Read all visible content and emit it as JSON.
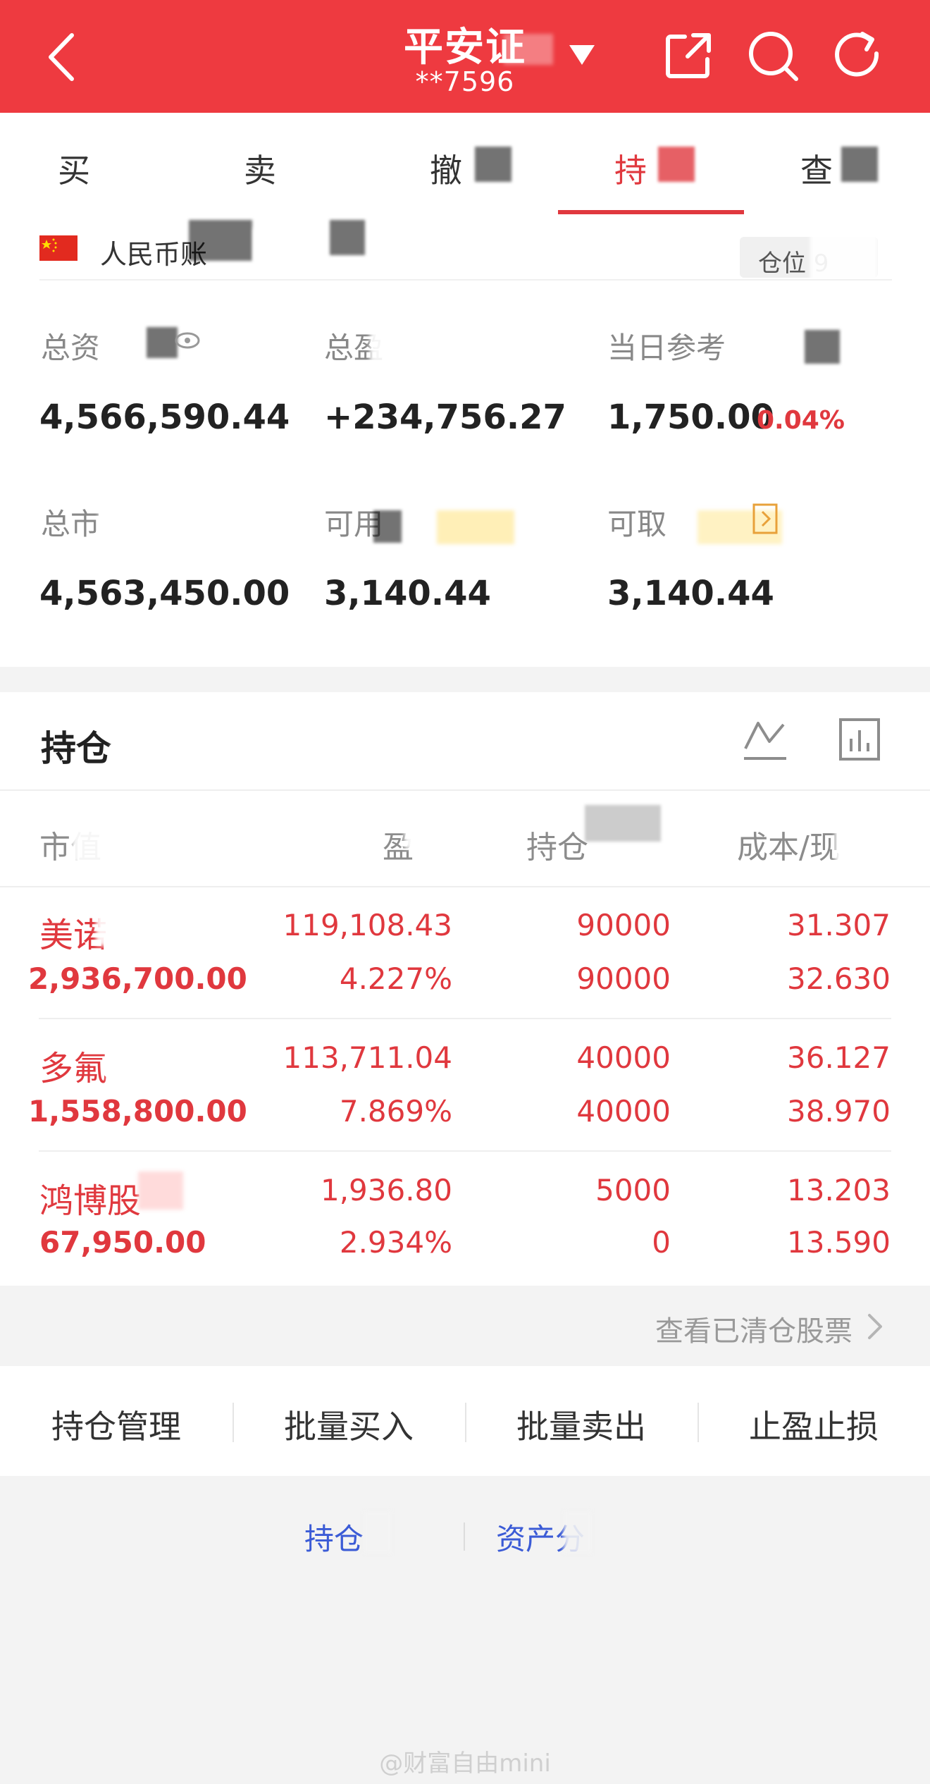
{
  "header": {
    "broker_name": "平安证",
    "account_masked": "**7596"
  },
  "tabs": [
    {
      "label": "买"
    },
    {
      "label": "卖"
    },
    {
      "label": "撤"
    },
    {
      "label": "持"
    },
    {
      "label": "查"
    }
  ],
  "account": {
    "currency_label": "人民币账",
    "position_badge": "仓位 9",
    "total_assets_label": "总资",
    "total_assets": "4,566,590.44",
    "total_pnl_label": "总盈",
    "total_pnl": "+234,756.27",
    "daily_ref_label": "当日参考",
    "daily_ref_value": "1,750.00",
    "daily_ref_pct": "0.04%",
    "total_market_label": "总市",
    "total_market_value": "4,563,450.00",
    "available_label": "可用",
    "available_value": "3,140.44",
    "withdrawable_label": "可取",
    "withdrawable_value": "3,140.44"
  },
  "holdings": {
    "title": "持仓",
    "columns": [
      "市值",
      "盈",
      "持仓",
      "成本/现"
    ],
    "rows": [
      {
        "name": "美诺",
        "market_value": "2,936,700.00",
        "pnl": "119,108.43",
        "pnl_pct": "4.227%",
        "qty": "90000",
        "available": "90000",
        "cost": "31.307",
        "price": "32.630"
      },
      {
        "name": "多氟",
        "market_value": "1,558,800.00",
        "pnl": "113,711.04",
        "pnl_pct": "7.869%",
        "qty": "40000",
        "available": "40000",
        "cost": "36.127",
        "price": "38.970"
      },
      {
        "name": "鸿博股",
        "market_value": "67,950.00",
        "pnl": "1,936.80",
        "pnl_pct": "2.934%",
        "qty": "5000",
        "available": "0",
        "cost": "13.203",
        "price": "13.590"
      }
    ]
  },
  "cleared_link": "查看已清仓股票",
  "actions": [
    "持仓管理",
    "批量买入",
    "批量卖出",
    "止盈止损"
  ],
  "bottom_links": [
    "持仓",
    "资产分"
  ],
  "watermark": "@财富自由mini",
  "colors": {
    "brand_red": "#ee3a40",
    "text_red": "#e0383e",
    "link_blue": "#3b5bd6"
  }
}
